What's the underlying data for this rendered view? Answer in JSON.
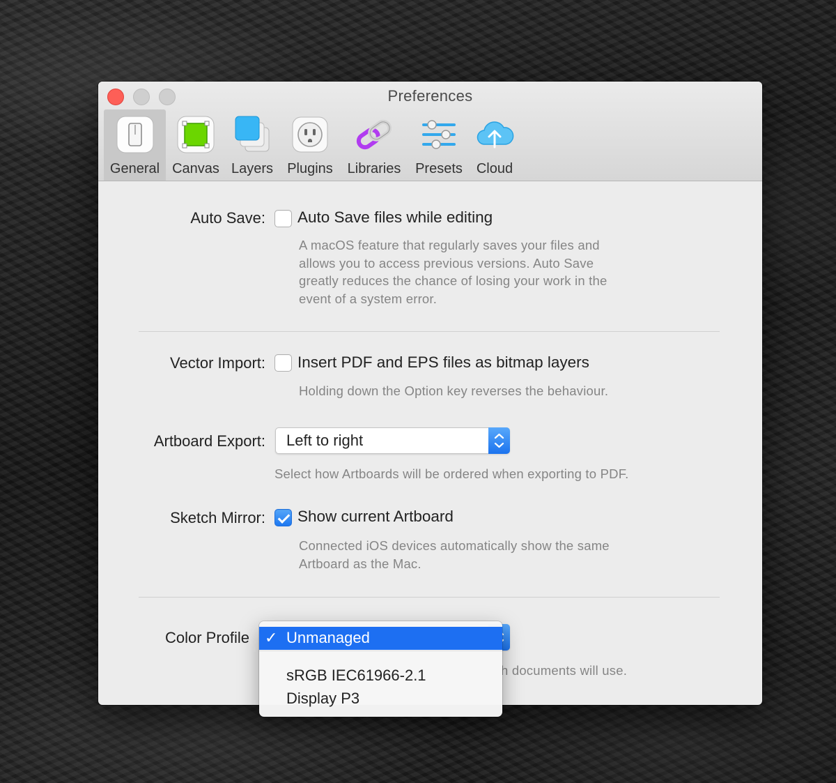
{
  "window": {
    "title": "Preferences"
  },
  "toolbar": {
    "items": [
      {
        "label": "General",
        "icon": "general-switch-icon",
        "selected": true
      },
      {
        "label": "Canvas",
        "icon": "canvas-square-icon"
      },
      {
        "label": "Layers",
        "icon": "layers-icon"
      },
      {
        "label": "Plugins",
        "icon": "plugins-outlet-icon"
      },
      {
        "label": "Libraries",
        "icon": "libraries-link-icon"
      },
      {
        "label": "Presets",
        "icon": "presets-sliders-icon"
      },
      {
        "label": "Cloud",
        "icon": "cloud-upload-icon"
      }
    ]
  },
  "general": {
    "auto_save": {
      "label": "Auto Save:",
      "option": "Auto Save files while editing",
      "checked": false,
      "help": [
        "A macOS feature that regularly saves your files and",
        "allows you to access previous versions. Auto Save",
        "greatly reduces the chance of losing your work in the",
        "event of a system error."
      ]
    },
    "vector_import": {
      "label": "Vector Import:",
      "option": "Insert PDF and EPS files as bitmap layers",
      "checked": false,
      "help": "Holding down the Option key reverses the behaviour."
    },
    "artboard_export": {
      "label": "Artboard Export:",
      "value": "Left to right",
      "help": "Select how Artboards will be ordered when exporting to PDF."
    },
    "sketch_mirror": {
      "label": "Sketch Mirror:",
      "option": "Show current Artboard",
      "checked": true,
      "help": [
        "Connected iOS devices automatically show the same",
        "Artboard as the Mac."
      ]
    },
    "color_profile": {
      "label": "Color Profile:",
      "label_visible": "Color Profile",
      "help_visible": "h documents will use.",
      "menu": {
        "selected_check": "✓",
        "items": [
          "Unmanaged",
          "sRGB IEC61966-2.1",
          "Display P3"
        ]
      }
    }
  },
  "colors": {
    "accent": "#1d6ff2",
    "close": "#fd5f57",
    "canvas_green": "#6bd600",
    "layers_blue": "#38b6f5",
    "libraries_purple": "#b13cf0"
  }
}
